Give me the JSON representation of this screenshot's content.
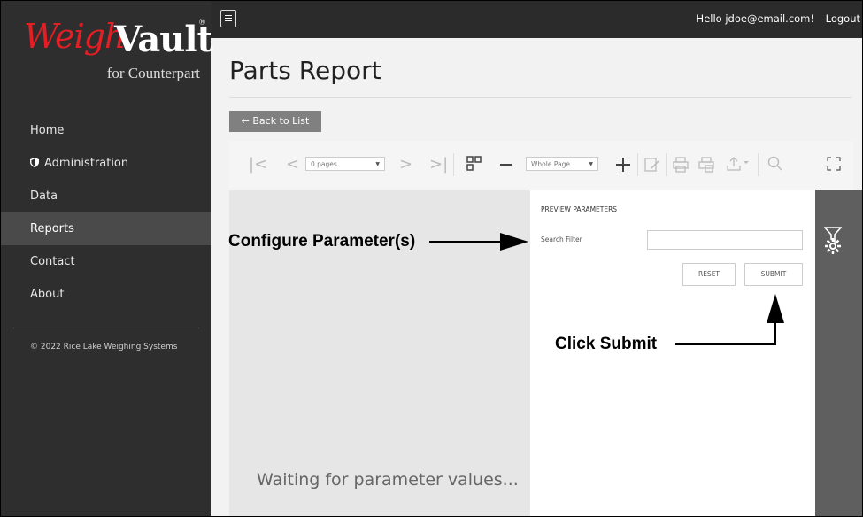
{
  "logo": {
    "brand_a": "Weigh",
    "brand_b": "Vault",
    "sub": "for Counterpart",
    "reg": "®"
  },
  "sidebar": {
    "items": [
      {
        "label": "Home",
        "icon": ""
      },
      {
        "label": "Administration",
        "icon": "shield-icon"
      },
      {
        "label": "Data",
        "icon": ""
      },
      {
        "label": "Reports",
        "icon": "",
        "active": true
      },
      {
        "label": "Contact",
        "icon": ""
      },
      {
        "label": "About",
        "icon": ""
      }
    ],
    "copyright": "© 2022 Rice Lake Weighing Systems"
  },
  "topbar": {
    "greeting": "Hello jdoe@email.com!",
    "logout": "Logout"
  },
  "page": {
    "title": "Parts Report",
    "back": "← Back to List"
  },
  "toolbar": {
    "pages": "0 pages",
    "zoom": "Whole Page"
  },
  "preview": {
    "title": "PREVIEW PARAMETERS",
    "search_label": "Search Filter",
    "search_value": "",
    "reset": "RESET",
    "submit": "SUBMIT",
    "waiting": "Waiting for parameter values..."
  },
  "annotations": {
    "configure": "Configure Parameter(s)",
    "submit": "Click Submit"
  },
  "colors": {
    "sidebar": "#2e2e2e",
    "brand_red": "#e31e24",
    "active": "#4a4a4a"
  }
}
